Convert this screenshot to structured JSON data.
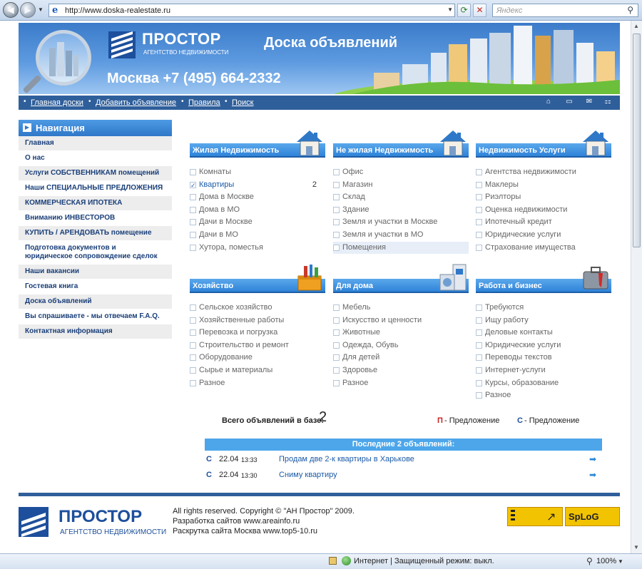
{
  "browser": {
    "url": "http://www.doska-realestate.ru",
    "search_placeholder": "Яндекс"
  },
  "header": {
    "logo_name": "ПРОСТОР",
    "logo_sub": "АГЕНТСТВО НЕДВИЖИМОСТИ",
    "board_title": "Доска объявлений",
    "phone": "Москва +7 (495) 664-2332"
  },
  "topnav": {
    "items": [
      "Главная доски",
      "Добавить объявление",
      "Правила",
      "Поиск"
    ],
    "bullet": "•"
  },
  "sidebar": {
    "title": "Навигация",
    "items": [
      "Главная",
      "О нас",
      "Услуги СОБСТВЕННИКАМ помещений",
      "Наши СПЕЦИАЛЬНЫЕ ПРЕДЛОЖЕНИЯ",
      "КОММЕРЧЕСКАЯ ИПОТЕКА",
      "Вниманию ИНВЕСТОРОВ",
      "КУПИТЬ / АРЕНДОВАТЬ помещение",
      "Подготовка документов и юридическое сопровождение сделок",
      "Наши вакансии",
      "Гостевая книга",
      "Доска объявлений",
      "Вы спрашиваете - мы отвечаем F.A.Q.",
      "Контактная информация"
    ]
  },
  "categories": [
    {
      "title": "Жилая Недвижимость",
      "icon": "house-icon",
      "items": [
        "Комнаты",
        "Квартиры",
        "Дома в Москве",
        "Дома в МО",
        "Дачи в Москве",
        "Дачи в МО",
        "Хутора, поместья"
      ],
      "checked_index": 1,
      "count": "2"
    },
    {
      "title": "Не жилая Недвижимость",
      "icon": "house-icon",
      "items": [
        "Офис",
        "Магазин",
        "Склад",
        "Здание",
        "Земля и участки в Москве",
        "Земля и участки в МО",
        "Помещения"
      ]
    },
    {
      "title": "Недвижимость Услуги",
      "icon": "house-icon",
      "items": [
        "Агентства недвижимости",
        "Маклеры",
        "Риэлторы",
        "Оценка недвижимости",
        "Ипотечный кредит",
        "Юридические услуги",
        "Страхование имущества"
      ]
    },
    {
      "title": "Хозяйство",
      "icon": "toolbox-icon",
      "items": [
        "Сельское хозяйство",
        "Хозяйственные работы",
        "Перевозка и погрузка",
        "Строительство и ремонт",
        "Оборудование",
        "Сырье и материалы",
        "Разное"
      ]
    },
    {
      "title": "Для дома",
      "icon": "appliances-icon",
      "items": [
        "Мебель",
        "Искусство и ценности",
        "Животные",
        "Одежда, Обувь",
        "Для детей",
        "Здоровье",
        "Разное"
      ]
    },
    {
      "title": "Работа и бизнес",
      "icon": "briefcase-icon",
      "items": [
        "Требуются",
        "Ищу работу",
        "Деловые контакты",
        "Юридические услуги",
        "Переводы текстов",
        "Интернет-услуги",
        "Курсы, образование",
        "Разное"
      ]
    }
  ],
  "totals": {
    "label": "Всего объявлений в базе:",
    "value": "2",
    "legend": [
      {
        "letter": "П",
        "text": "- Предложение",
        "color": "#cc2222"
      },
      {
        "letter": "С",
        "text": "- Предложение",
        "color": "#1d4f9c"
      }
    ]
  },
  "recent": {
    "title": "Последние 2 объявлений:",
    "rows": [
      {
        "type": "С",
        "date": "22.04",
        "time": "13:33",
        "title": "Продам две 2-к квартиры в Харькове"
      },
      {
        "type": "С",
        "date": "22.04",
        "time": "13:30",
        "title": "Сниму квартиру"
      }
    ]
  },
  "footer": {
    "logo_name": "ПРОСТОР",
    "logo_sub": "АГЕНТСТВО НЕДВИЖИМОСТИ",
    "lines": [
      "All rights reserved. Copyright © \"АН Простор\" 2009.",
      "Разработка сайтов www.areainfo.ru",
      "Раскрутка сайта Москва www.top5-10.ru"
    ],
    "counter_label": "SpLoG"
  },
  "statusbar": {
    "zone": "Интернет | Защищенный режим: выкл.",
    "zoom": "100%"
  },
  "colors": {
    "brand_blue": "#2f5f9b",
    "accent_blue": "#4da6ea",
    "link_blue": "#1a5aa8"
  }
}
